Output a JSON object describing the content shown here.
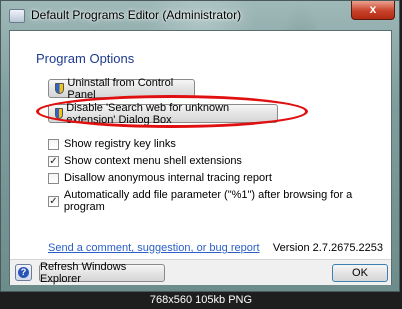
{
  "window": {
    "title": "Default Programs Editor (Administrator)",
    "close_label": "x"
  },
  "dialog": {
    "section_title": "Program Options",
    "buttons": {
      "uninstall": "Uninstall from Control Panel",
      "disable": "Disable 'Search web for unknown extension' Dialog Box"
    },
    "options": [
      {
        "label": "Show registry key links",
        "checked": false
      },
      {
        "label": "Show context menu shell extensions",
        "checked": true
      },
      {
        "label": "Disallow anonymous internal tracing report",
        "checked": false
      },
      {
        "label": "Automatically add file parameter (\"%1\") after browsing for a program",
        "checked": true
      }
    ],
    "feedback_link": "Send a comment, suggestion, or bug report",
    "version": "Version 2.7.2675.2253"
  },
  "footer": {
    "help_glyph": "?",
    "refresh_label": "Refresh Windows Explorer",
    "ok_label": "OK"
  },
  "caption": "768x560 105kb PNG",
  "colors": {
    "highlight": "#e01010",
    "title_blue": "#1e3a8c",
    "link": "#2a5fc7"
  }
}
